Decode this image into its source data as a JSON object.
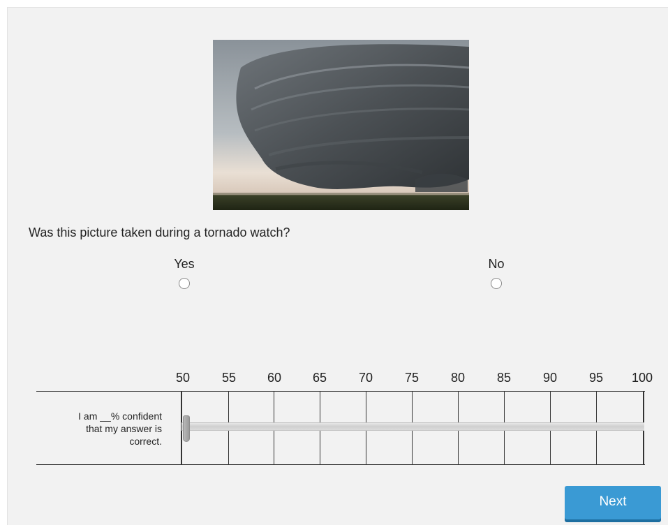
{
  "question": {
    "text": "Was this picture taken during a tornado watch?"
  },
  "choices": [
    {
      "label": "Yes"
    },
    {
      "label": "No"
    }
  ],
  "confidence_scale": {
    "ticks": [
      "50",
      "55",
      "60",
      "65",
      "70",
      "75",
      "80",
      "85",
      "90",
      "95",
      "100"
    ],
    "label_line1": "I am __% confident",
    "label_line2": "that my answer is",
    "label_line3": "correct.",
    "selected_value": 50
  },
  "navigation": {
    "next_label": "Next"
  },
  "colors": {
    "page_background": "#f2f2f2",
    "next_button": "#3a9ad4"
  },
  "icons": {
    "photo": "supercell-storm-photo"
  }
}
